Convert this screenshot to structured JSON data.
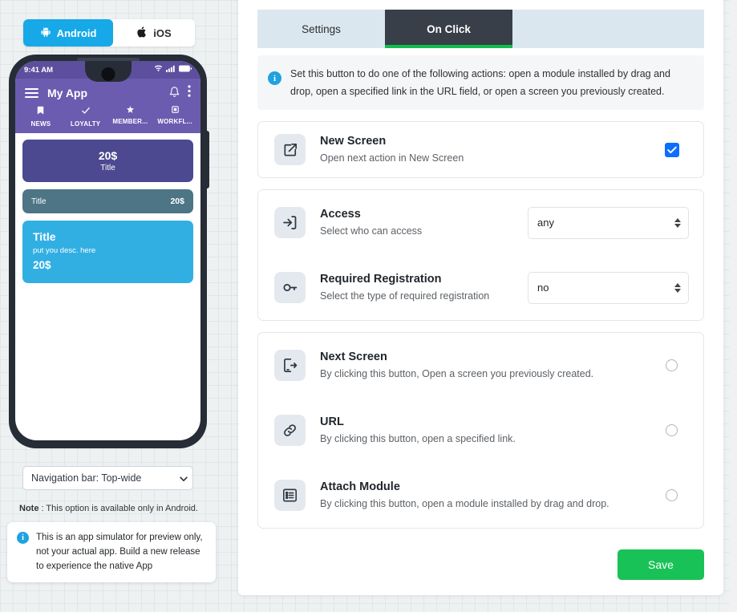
{
  "simulator": {
    "platform_toggle": {
      "android_label": "Android",
      "ios_label": "iOS",
      "active": "Android"
    },
    "phone": {
      "status_time": "9:41 AM",
      "app_title": "My App",
      "tabs": [
        {
          "label": "NEWS",
          "icon": "bookmark-icon"
        },
        {
          "label": "LOYALTY",
          "icon": "check-icon"
        },
        {
          "label": "MEMBER...",
          "icon": "star-icon"
        },
        {
          "label": "WORKFL...",
          "icon": "square-icon"
        }
      ],
      "cards": [
        {
          "price": "20$",
          "title": "Title"
        },
        {
          "title": "Title",
          "price": "20$"
        },
        {
          "title": "Title",
          "desc": "put you desc. here",
          "price": "20$"
        }
      ]
    },
    "navbar_select": {
      "value": "Navigation bar: Top-wide",
      "options": [
        "Navigation bar: Top-wide"
      ]
    },
    "note_label": "Note",
    "note_text": " : This option is available only in Android.",
    "info_text": "This is an app simulator for preview only, not your actual app. Build a new release to experience the native App"
  },
  "panel": {
    "tabs": [
      {
        "label": "Settings",
        "active": false
      },
      {
        "label": "On Click",
        "active": true
      }
    ],
    "info_banner": "Set this button to do one of the following actions: open a module installed by drag and drop, open a specified link in the URL field, or open a screen you previously created.",
    "new_screen": {
      "title": "New Screen",
      "subtitle": "Open next action in New Screen",
      "icon": "external-link-icon",
      "checked": true
    },
    "access_card": [
      {
        "title": "Access",
        "subtitle": "Select who can access",
        "icon": "sign-in-icon",
        "value": "any",
        "options": [
          "any"
        ]
      },
      {
        "title": "Required Registration",
        "subtitle": "Select the type of required registration",
        "icon": "key-icon",
        "value": "no",
        "options": [
          "no"
        ]
      }
    ],
    "action_options": [
      {
        "title": "Next Screen",
        "subtitle": "By clicking this button, Open a screen you previously created.",
        "icon": "mobile-arrow-icon",
        "selected": false
      },
      {
        "title": "URL",
        "subtitle": "By clicking this button, open a specified link.",
        "icon": "link-icon",
        "selected": false
      },
      {
        "title": "Attach Module",
        "subtitle": "By clicking this button, open a module installed by drag and drop.",
        "icon": "list-box-icon",
        "selected": false
      }
    ],
    "save_label": "Save"
  },
  "colors": {
    "accent_blue": "#17a8e8",
    "active_tab_bg": "#383f48",
    "tab_underline_green": "#0fbf4e",
    "save_green": "#19c257",
    "checkbox_blue": "#0d6efd",
    "phone_purple": "#6b5cb0"
  }
}
